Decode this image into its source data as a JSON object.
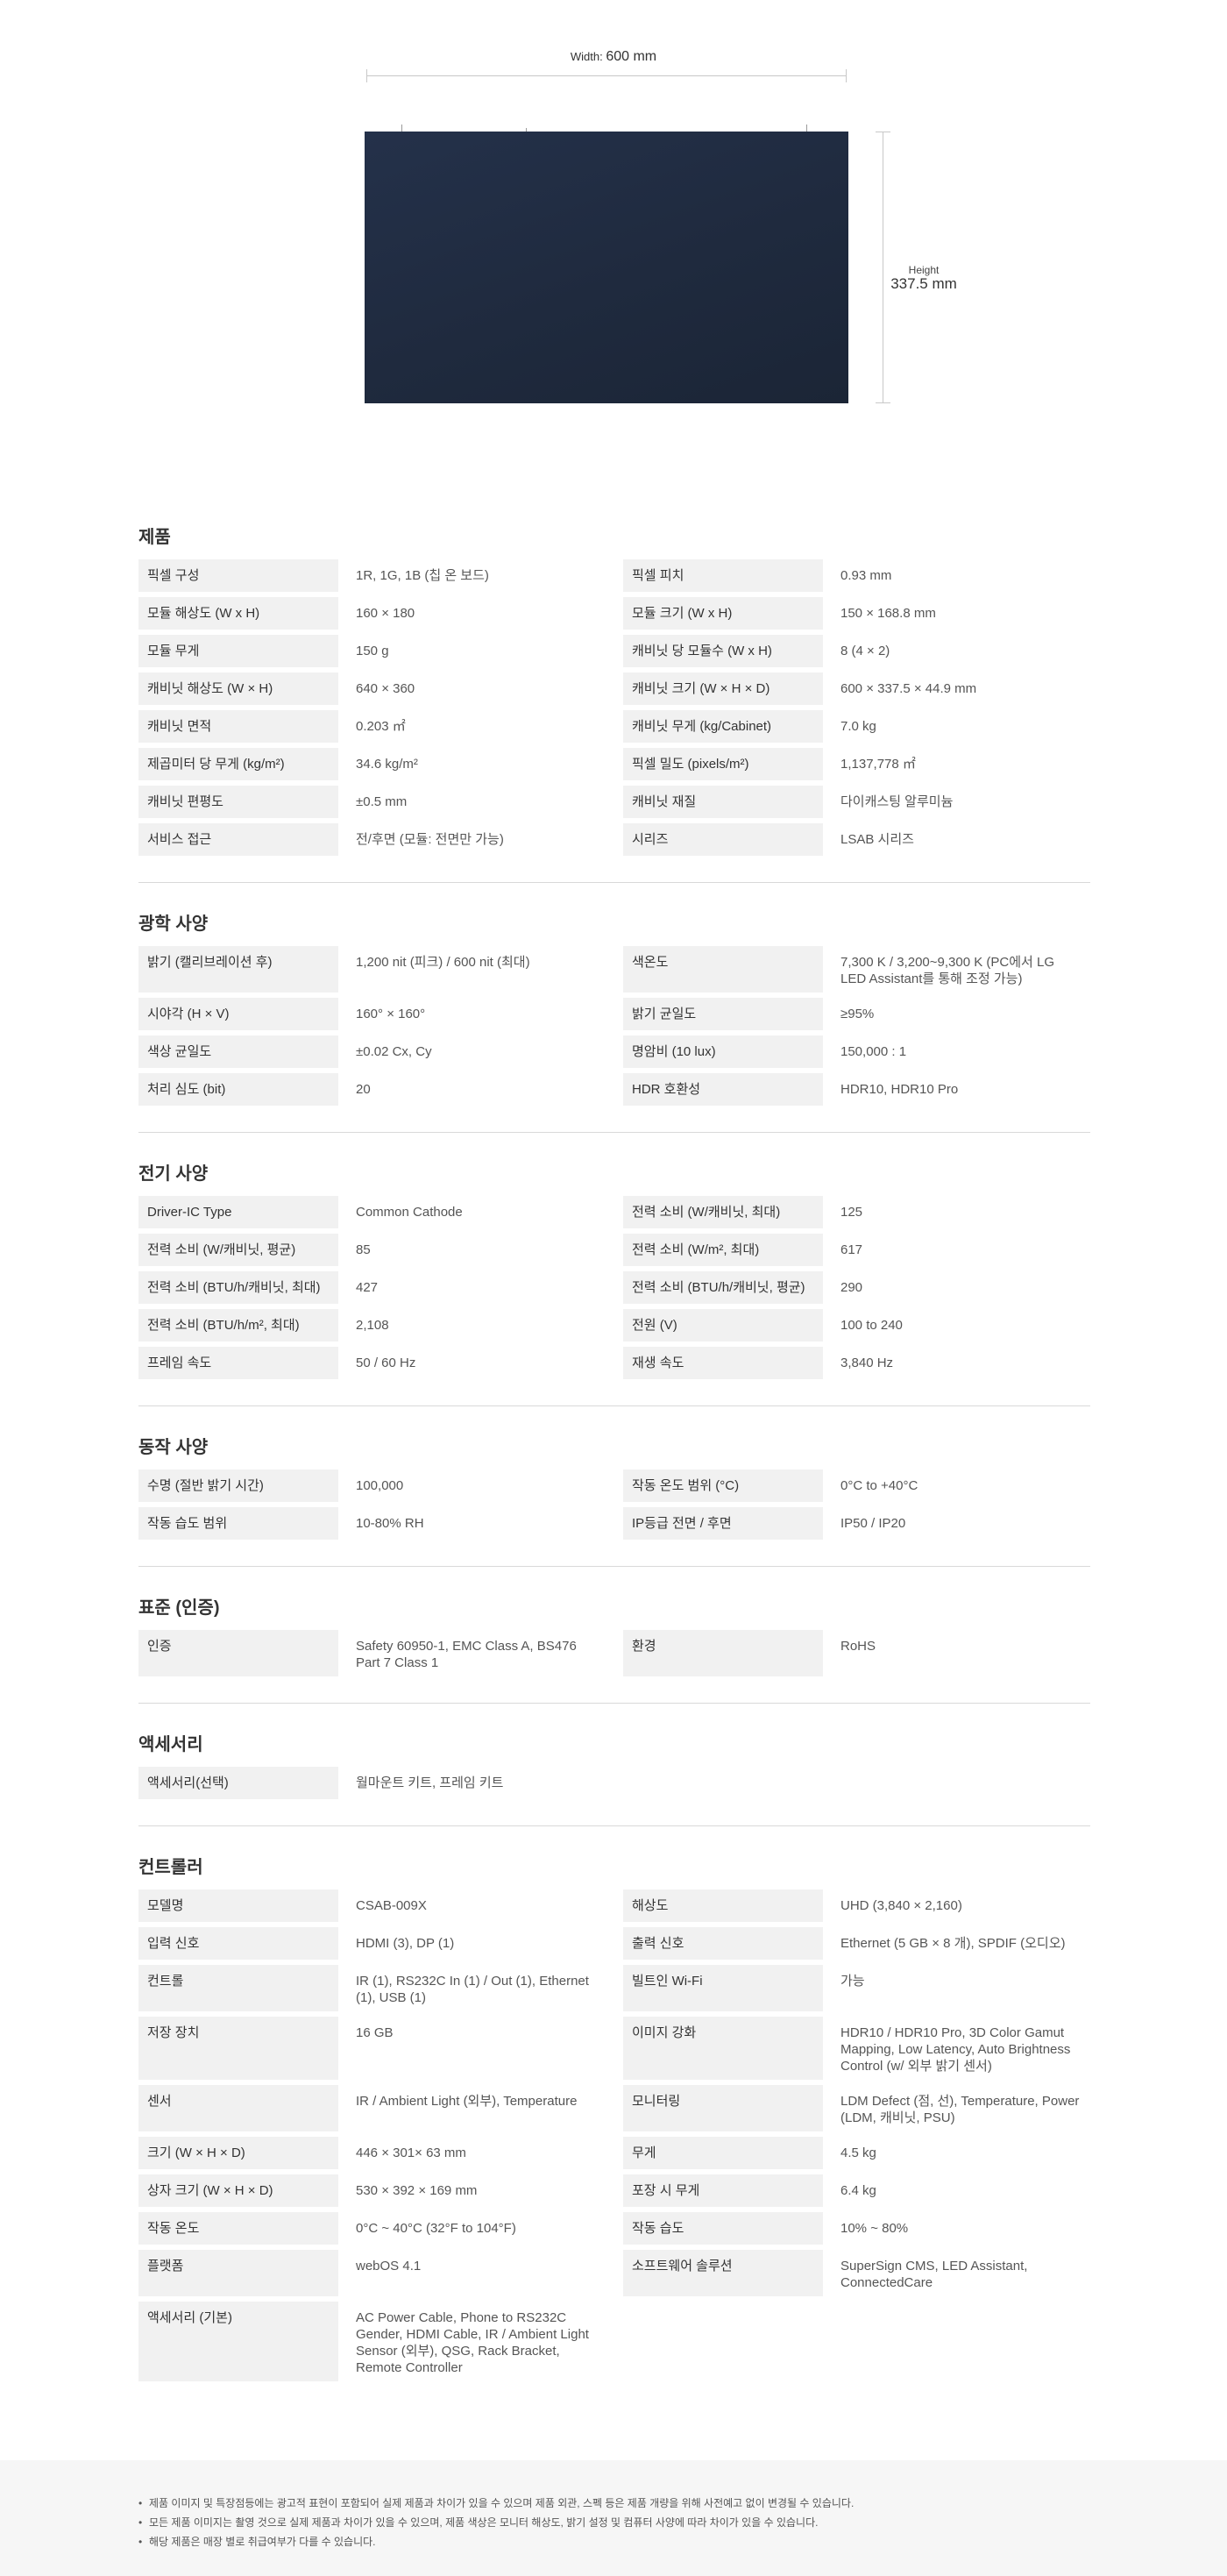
{
  "dimensions": {
    "width_caption": "Width",
    "width_value": "600 mm",
    "height_caption": "Height",
    "height_value": "337.5 mm"
  },
  "sections": [
    {
      "title": "제품",
      "rows": [
        [
          "픽셀 구성",
          "1R, 1G, 1B (칩 온 보드)",
          "픽셀 피치",
          "0.93 mm"
        ],
        [
          "모듈 해상도 (W x H)",
          "160 × 180",
          "모듈 크기 (W x H)",
          "150 × 168.8 mm"
        ],
        [
          "모듈 무게",
          "150 g",
          "캐비닛 당 모듈수 (W x H)",
          "8 (4 × 2)"
        ],
        [
          "캐비닛 해상도 (W × H)",
          "640 × 360",
          "캐비닛 크기 (W × H × D)",
          "600 × 337.5 × 44.9 mm"
        ],
        [
          "캐비닛 면적",
          "0.203 ㎡",
          "캐비닛 무게 (kg/Cabinet)",
          "7.0 kg"
        ],
        [
          "제곱미터 당 무게 (kg/m²)",
          "34.6 kg/m²",
          "픽셀 밀도 (pixels/m²)",
          "1,137,778 ㎡"
        ],
        [
          "캐비닛 편평도",
          "±0.5 mm",
          "캐비닛 재질",
          "다이캐스팅 알루미늄"
        ],
        [
          "서비스 접근",
          "전/후면 (모듈: 전면만 가능)",
          "시리즈",
          "LSAB 시리즈"
        ]
      ]
    },
    {
      "title": "광학 사양",
      "rows": [
        [
          "밝기 (캘리브레이션 후)",
          "1,200 nit (피크) / 600 nit (최대)",
          "색온도",
          "7,300 K / 3,200~9,300 K (PC에서 LG LED Assistant를 통해 조정 가능)"
        ],
        [
          "시야각 (H × V)",
          "160° × 160°",
          "밝기 균일도",
          "≥95%"
        ],
        [
          "색상 균일도",
          "±0.02 Cx, Cy",
          "명암비 (10 lux)",
          "150,000 : 1"
        ],
        [
          "처리 심도 (bit)",
          "20",
          "HDR 호환성",
          "HDR10, HDR10 Pro"
        ]
      ]
    },
    {
      "title": "전기 사양",
      "rows": [
        [
          "Driver-IC Type",
          "Common Cathode",
          "전력 소비 (W/캐비닛, 최대)",
          "125"
        ],
        [
          "전력 소비 (W/캐비닛, 평균)",
          "85",
          "전력 소비 (W/m², 최대)",
          "617"
        ],
        [
          "전력 소비 (BTU/h/캐비닛, 최대)",
          "427",
          "전력 소비 (BTU/h/캐비닛, 평균)",
          "290"
        ],
        [
          "전력 소비 (BTU/h/m², 최대)",
          "2,108",
          "전원 (V)",
          "100 to 240"
        ],
        [
          "프레임 속도",
          "50 / 60 Hz",
          "재생 속도",
          "3,840 Hz"
        ]
      ]
    },
    {
      "title": "동작 사양",
      "rows": [
        [
          "수명 (절반 밝기 시간)",
          "100,000",
          "작동 온도 범위 (°C)",
          "0°C to +40°C"
        ],
        [
          "작동 습도 범위",
          "10-80% RH",
          "IP등급 전면 / 후면",
          "IP50 / IP20"
        ]
      ]
    },
    {
      "title": "표준 (인증)",
      "rows": [
        [
          "인증",
          "Safety 60950-1, EMC Class A, BS476 Part 7 Class 1",
          "환경",
          "RoHS"
        ]
      ]
    },
    {
      "title": "액세서리",
      "rows": [
        [
          "액세서리(선택)",
          "월마운트 키트, 프레임 키트",
          "",
          ""
        ]
      ]
    },
    {
      "title": "컨트롤러",
      "rows": [
        [
          "모델명",
          "CSAB-009X",
          "해상도",
          "UHD (3,840 × 2,160)"
        ],
        [
          "입력 신호",
          "HDMI (3), DP (1)",
          "출력 신호",
          "Ethernet (5 GB × 8 개), SPDIF (오디오)"
        ],
        [
          "컨트롤",
          "IR (1), RS232C In (1) / Out (1), Ethernet (1), USB (1)",
          "빌트인 Wi-Fi",
          "가능"
        ],
        [
          "저장 장치",
          "16 GB",
          "이미지 강화",
          "HDR10 / HDR10 Pro, 3D Color Gamut Mapping, Low Latency, Auto Brightness Control (w/ 외부 밝기 센서)"
        ],
        [
          "센서",
          "IR / Ambient Light (외부), Temperature",
          "모니터링",
          "LDM Defect (점, 선), Temperature, Power (LDM, 캐비닛, PSU)"
        ],
        [
          "크기 (W × H × D)",
          "446 × 301× 63 mm",
          "무게",
          "4.5 kg"
        ],
        [
          "상자 크기 (W × H × D)",
          "530 × 392 × 169 mm",
          "포장 시 무게",
          "6.4 kg"
        ],
        [
          "작동 온도",
          "0°C ~ 40°C (32°F to 104°F)",
          "작동 습도",
          "10% ~ 80%"
        ],
        [
          "플랫폼",
          "webOS 4.1",
          "소프트웨어 솔루션",
          "SuperSign CMS, LED Assistant, ConnectedCare"
        ],
        [
          "액세서리 (기본)",
          "AC Power Cable, Phone to RS232C Gender, HDMI Cable, IR / Ambient Light Sensor (외부), QSG, Rack Bracket, Remote Controller",
          "",
          ""
        ]
      ]
    }
  ],
  "footnotes": [
    "제품 이미지 및 특장점등에는 광고적 표현이 포함되어 실제 제품과 차이가 있을 수 있으며 제품 외관, 스펙 등은 제품 개량을 위해 사전예고 없이 변경될 수 있습니다.",
    "모든 제품 이미지는 촬영 것으로 실제 제품과 차이가 있을 수 있으며, 제품 색상은 모니터 해상도, 밝기 설정 및 컴퓨터 사양에 따라 차이가 있을 수 있습니다.",
    "해당 제품은 매장 별로 취급여부가 다를 수 있습니다."
  ]
}
